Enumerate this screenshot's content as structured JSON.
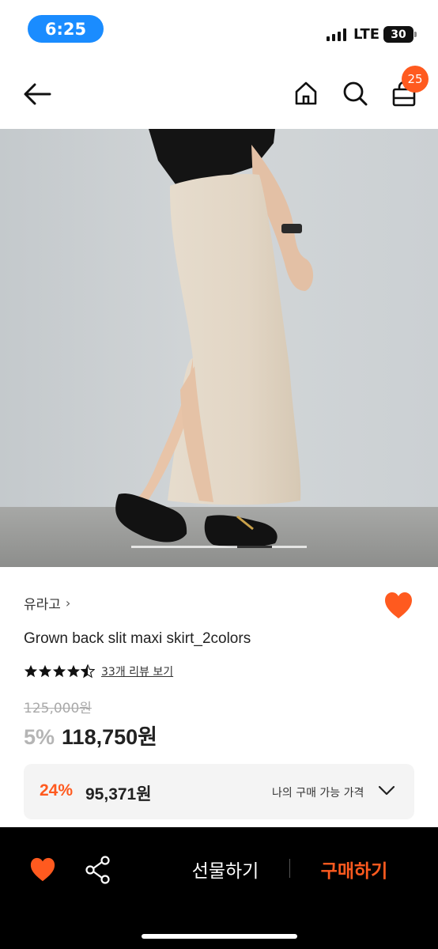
{
  "status_bar": {
    "time": "6:25",
    "network": "LTE",
    "battery": "30"
  },
  "nav": {
    "cart_count": "25"
  },
  "product": {
    "brand": "유라고",
    "brand_chevron": "›",
    "name": "Grown back slit maxi skirt_2colors",
    "rating": 4.5,
    "review_link": "33개 리뷰 보기",
    "original_price": "125,000원",
    "discount": "5%",
    "price": "118,750원",
    "image_page": 3,
    "image_pages": 5
  },
  "my_price": {
    "discount": "24%",
    "price": "95,371원",
    "label": "나의 구매 가능 가격"
  },
  "bottom_bar": {
    "gift_label": "선물하기",
    "buy_label": "구매하기"
  },
  "colors": {
    "accent": "#ff5a1f",
    "time_pill": "#1a8cff"
  }
}
